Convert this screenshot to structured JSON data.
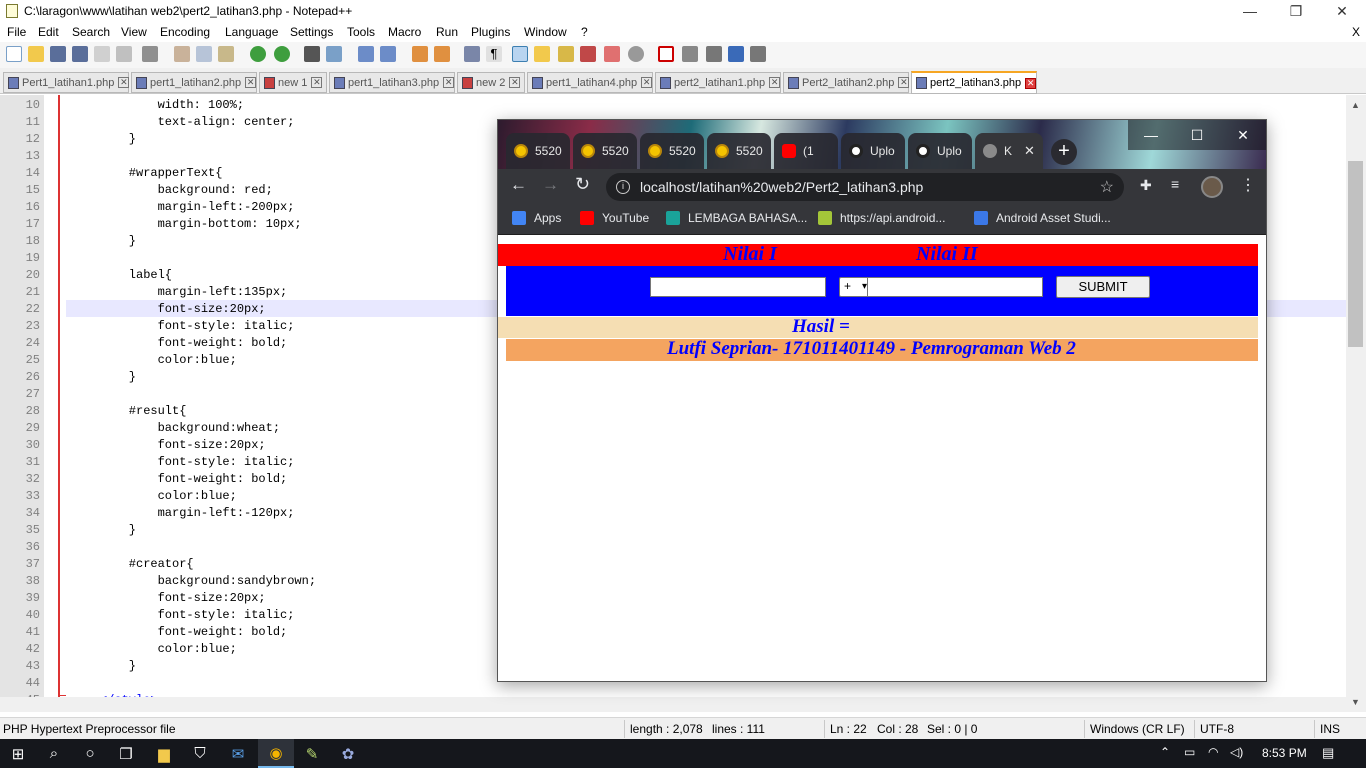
{
  "notepad": {
    "title": "C:\\laragon\\www\\latihan web2\\pert2_latihan3.php - Notepad++",
    "menu": [
      "File",
      "Edit",
      "Search",
      "View",
      "Encoding",
      "Language",
      "Settings",
      "Tools",
      "Macro",
      "Run",
      "Plugins",
      "Window",
      "?"
    ],
    "menu_close": "X",
    "tabs": [
      {
        "label": "Pert1_latihan1.php"
      },
      {
        "label": "pert1_latihan2.php"
      },
      {
        "label": "new 1"
      },
      {
        "label": "pert1_latihan3.php"
      },
      {
        "label": "new 2"
      },
      {
        "label": "pert1_latihan4.php"
      },
      {
        "label": "pert2_latihan1.php"
      },
      {
        "label": "Pert2_latihan2.php"
      },
      {
        "label": "pert2_latihan3.php"
      }
    ],
    "lines": [
      {
        "n": "10",
        "text": "        width: 100%;"
      },
      {
        "n": "11",
        "text": "        text-align: center;"
      },
      {
        "n": "12",
        "text": "    }"
      },
      {
        "n": "13",
        "text": ""
      },
      {
        "n": "14",
        "text": "    #wrapperText{"
      },
      {
        "n": "15",
        "text": "        background: red;"
      },
      {
        "n": "16",
        "text": "        margin-left:-200px;"
      },
      {
        "n": "17",
        "text": "        margin-bottom: 10px;"
      },
      {
        "n": "18",
        "text": "    }"
      },
      {
        "n": "19",
        "text": ""
      },
      {
        "n": "20",
        "text": "    label{"
      },
      {
        "n": "21",
        "text": "        margin-left:135px;"
      },
      {
        "n": "22",
        "text": "        font-size:20px;"
      },
      {
        "n": "23",
        "text": "        font-style: italic;"
      },
      {
        "n": "24",
        "text": "        font-weight: bold;"
      },
      {
        "n": "25",
        "text": "        color:blue;"
      },
      {
        "n": "26",
        "text": "    }"
      },
      {
        "n": "27",
        "text": ""
      },
      {
        "n": "28",
        "text": "    #result{"
      },
      {
        "n": "29",
        "text": "        background:wheat;"
      },
      {
        "n": "30",
        "text": "        font-size:20px;"
      },
      {
        "n": "31",
        "text": "        font-style: italic;"
      },
      {
        "n": "32",
        "text": "        font-weight: bold;"
      },
      {
        "n": "33",
        "text": "        color:blue;"
      },
      {
        "n": "34",
        "text": "        margin-left:-120px;"
      },
      {
        "n": "35",
        "text": "    }"
      },
      {
        "n": "36",
        "text": ""
      },
      {
        "n": "37",
        "text": "    #creator{"
      },
      {
        "n": "38",
        "text": "        background:sandybrown;"
      },
      {
        "n": "39",
        "text": "        font-size:20px;"
      },
      {
        "n": "40",
        "text": "        font-style: italic;"
      },
      {
        "n": "41",
        "text": "        font-weight: bold;"
      },
      {
        "n": "42",
        "text": "        color:blue;"
      },
      {
        "n": "43",
        "text": "    }"
      },
      {
        "n": "44",
        "text": ""
      },
      {
        "n": "45",
        "text": "</style>"
      }
    ],
    "status": {
      "filetype": "PHP Hypertext Preprocessor file",
      "length": "length : 2,078",
      "lines": "lines : 111",
      "ln": "Ln : 22",
      "col": "Col : 28",
      "sel": "Sel : 0 | 0",
      "eol": "Windows (CR LF)",
      "encoding": "UTF-8",
      "mode": "INS"
    }
  },
  "chrome": {
    "tabs": [
      {
        "label": "5520",
        "icon": "yellow-favicon"
      },
      {
        "label": "5520",
        "icon": "yellow-favicon"
      },
      {
        "label": "5520",
        "icon": "yellow-favicon"
      },
      {
        "label": "5520",
        "icon": "yellow-favicon"
      },
      {
        "label": "(1",
        "icon": "youtube-icon"
      },
      {
        "label": "Uplo",
        "icon": "github-icon"
      },
      {
        "label": "Uplo",
        "icon": "github-icon"
      },
      {
        "label": "K",
        "icon": "globe-icon"
      }
    ],
    "url": "localhost/latihan%20web2/Pert2_latihan3.php",
    "bookmarks": [
      {
        "label": "Apps",
        "color": "#4285f4"
      },
      {
        "label": "YouTube",
        "color": "#ff0000"
      },
      {
        "label": "LEMBAGA BAHASA...",
        "color": "#1aa39a"
      },
      {
        "label": "https://api.android...",
        "color": "#a4c639"
      },
      {
        "label": "Android Asset Studi...",
        "color": "#3b78e7"
      }
    ],
    "page": {
      "label1": "Nilai I",
      "label2": "Nilai II",
      "input1": "",
      "operator": "+",
      "input2": "",
      "submit": "SUBMIT",
      "hasil": "Hasil =",
      "creator": "Lutfi Seprian- 171011401149 - Pemrograman Web 2"
    }
  },
  "taskbar": {
    "time": "8:53 PM"
  }
}
